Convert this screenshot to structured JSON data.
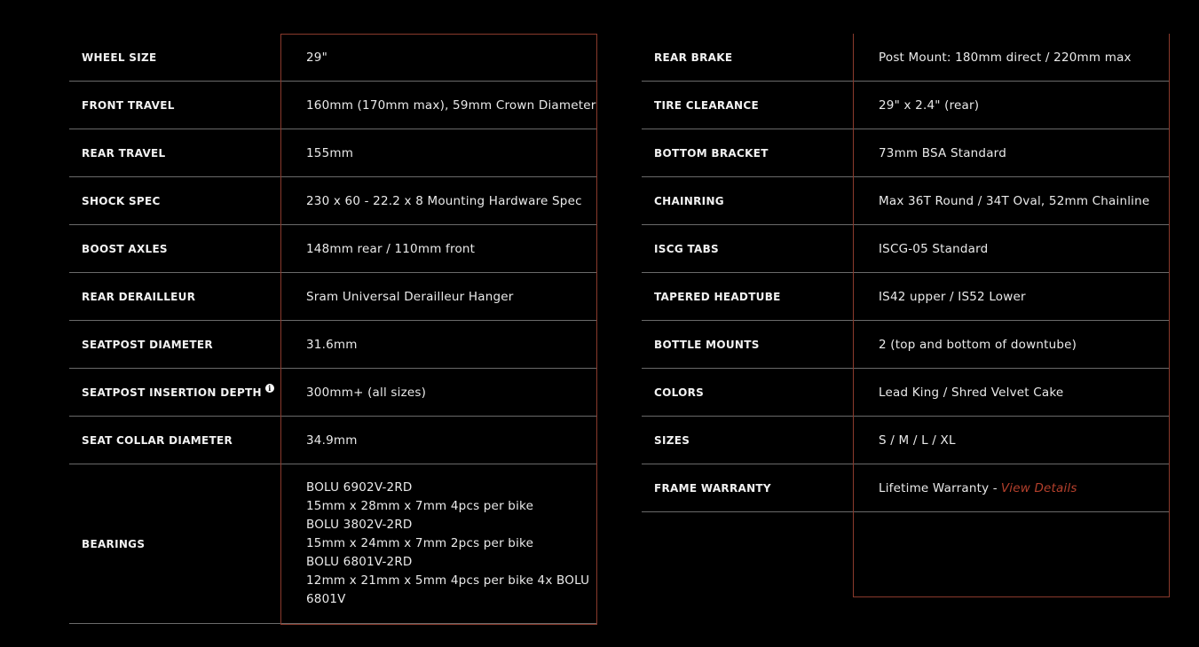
{
  "left": {
    "rows": [
      {
        "label": "WHEEL SIZE",
        "value": "29\""
      },
      {
        "label": "FRONT TRAVEL",
        "value": "160mm (170mm max), 59mm Crown Diameter"
      },
      {
        "label": "REAR TRAVEL",
        "value": "155mm"
      },
      {
        "label": "SHOCK SPEC",
        "value": "230 x 60 - 22.2 x 8 Mounting Hardware Spec"
      },
      {
        "label": "BOOST AXLES",
        "value": "148mm rear / 110mm front"
      },
      {
        "label": "REAR DERAILLEUR",
        "value": "Sram Universal Derailleur Hanger"
      },
      {
        "label": "SEATPOST DIAMETER",
        "value": "31.6mm"
      },
      {
        "label": "SEATPOST INSERTION DEPTH",
        "value": "300mm+ (all sizes)",
        "info_icon": "i"
      },
      {
        "label": "SEAT COLLAR DIAMETER",
        "value": "34.9mm"
      }
    ],
    "bearings": {
      "label": "BEARINGS",
      "lines": [
        "BOLU 6902V-2RD",
        "15mm x 28mm x 7mm 4pcs per bike",
        "BOLU 3802V-2RD",
        "15mm x 24mm x 7mm 2pcs per bike",
        "BOLU 6801V-2RD",
        "12mm x 21mm x 5mm 4pcs per bike 4x BOLU 6801V"
      ]
    }
  },
  "right": {
    "rows": [
      {
        "label": "REAR BRAKE",
        "value": "Post Mount: 180mm direct / 220mm max"
      },
      {
        "label": "TIRE CLEARANCE",
        "value": "29\" x 2.4\" (rear)"
      },
      {
        "label": "BOTTOM BRACKET",
        "value": "73mm BSA Standard"
      },
      {
        "label": "CHAINRING",
        "value": "Max 36T Round / 34T Oval, 52mm Chainline"
      },
      {
        "label": "ISCG TABS",
        "value": "ISCG-05 Standard"
      },
      {
        "label": "TAPERED HEADTUBE",
        "value": "IS42 upper / IS52 Lower"
      },
      {
        "label": "BOTTLE MOUNTS",
        "value": "2 (top and bottom of downtube)"
      },
      {
        "label": "COLORS",
        "value": "Lead King / Shred Velvet Cake"
      },
      {
        "label": "SIZES",
        "value": "S / M / L / XL"
      }
    ],
    "warranty": {
      "label": "FRAME WARRANTY",
      "value": "Lifetime Warranty -",
      "link": "View Details"
    }
  },
  "colors": {
    "background": "#000000",
    "frame": "#8a3a2c",
    "link": "#b5402c",
    "divider": "#6a6a6a"
  }
}
